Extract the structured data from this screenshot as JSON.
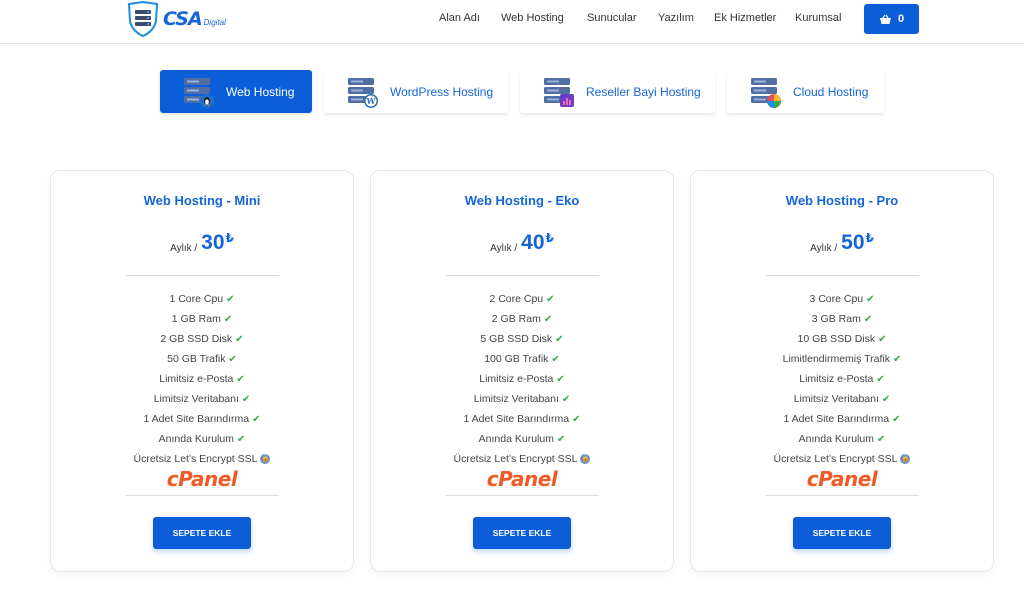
{
  "brand": {
    "name": "CSA",
    "tagline": "Digital",
    "color": "#1565d8"
  },
  "nav": {
    "items": [
      {
        "label": "Alan Adı"
      },
      {
        "label": "Web Hosting"
      },
      {
        "label": "Sunucular"
      },
      {
        "label": "Yazılım"
      },
      {
        "label": "Ek Hizmetler"
      },
      {
        "label": "Kurumsal"
      }
    ],
    "cart_count": "0",
    "cart_icon": "basket-icon"
  },
  "tabs": [
    {
      "label": "Web Hosting",
      "icon": "linux-server-icon",
      "active": true
    },
    {
      "label": "WordPress Hosting",
      "icon": "wordpress-server-icon",
      "active": false
    },
    {
      "label": "Reseller Bayi Hosting",
      "icon": "reseller-server-icon",
      "active": false
    },
    {
      "label": "Cloud Hosting",
      "icon": "cloud-server-icon",
      "active": false
    }
  ],
  "plans": [
    {
      "title": "Web Hosting - Mini",
      "price_prefix": "Aylık /",
      "price": "30",
      "currency": "₺",
      "features": [
        "1 Core Cpu",
        "1 GB Ram",
        "2 GB SSD Disk",
        "50 GB Trafik",
        "Limitsiz e-Posta",
        "Limitsiz Veritabanı",
        "1 Adet Site Barındırma",
        "Anında Kurulum"
      ],
      "ssl": "Ücretsiz Let's Encrypt SSL",
      "panel": "cPanel",
      "button": "SEPETE EKLE"
    },
    {
      "title": "Web Hosting - Eko",
      "price_prefix": "Aylık /",
      "price": "40",
      "currency": "₺",
      "features": [
        "2 Core Cpu",
        "2 GB Ram",
        "5 GB SSD Disk",
        "100 GB Trafik",
        "Limitsiz e-Posta",
        "Limitsiz Veritabanı",
        "1 Adet Site Barındırma",
        "Anında Kurulum"
      ],
      "ssl": "Ücretsiz Let's Encrypt SSL",
      "panel": "cPanel",
      "button": "SEPETE EKLE"
    },
    {
      "title": "Web Hosting - Pro",
      "price_prefix": "Aylık /",
      "price": "50",
      "currency": "₺",
      "features": [
        "3 Core Cpu",
        "3 GB Ram",
        "10 GB SSD Disk",
        "Limitlendirmemiş Trafik",
        "Limitsiz e-Posta",
        "Limitsiz Veritabanı",
        "1 Adet Site Barındırma",
        "Anında Kurulum"
      ],
      "ssl": "Ücretsiz Let's Encrypt SSL",
      "panel": "cPanel",
      "button": "SEPETE EKLE"
    }
  ],
  "colors": {
    "primary": "#0b5ed7",
    "check": "#3aa652",
    "cpanel": "#f05a24"
  }
}
